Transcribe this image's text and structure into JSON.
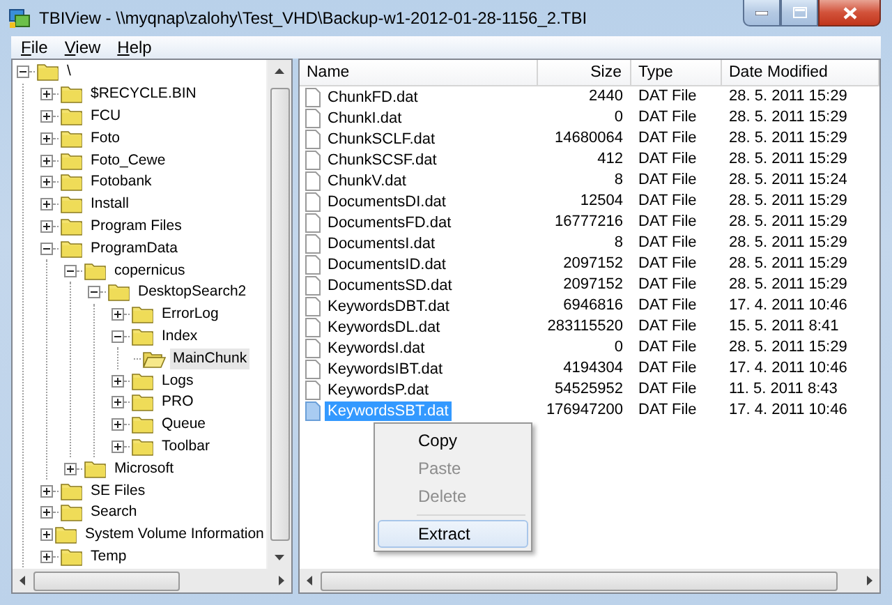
{
  "window": {
    "title": "TBIView - \\\\myqnap\\zalohy\\Test_VHD\\Backup-w1-2012-01-28-1156_2.TBI"
  },
  "menu": [
    {
      "label": "File"
    },
    {
      "label": "View"
    },
    {
      "label": "Help"
    }
  ],
  "tree": [
    {
      "label": "\\",
      "expanded": true,
      "selected": false,
      "children": [
        {
          "label": "$RECYCLE.BIN",
          "expanded": false,
          "selected": false
        },
        {
          "label": "FCU",
          "expanded": false,
          "selected": false
        },
        {
          "label": "Foto",
          "expanded": false,
          "selected": false
        },
        {
          "label": "Foto_Cewe",
          "expanded": false,
          "selected": false
        },
        {
          "label": "Fotobank",
          "expanded": false,
          "selected": false
        },
        {
          "label": "Install",
          "expanded": false,
          "selected": false
        },
        {
          "label": "Program Files",
          "expanded": false,
          "selected": false
        },
        {
          "label": "ProgramData",
          "expanded": true,
          "selected": false,
          "children": [
            {
              "label": "copernicus",
              "expanded": true,
              "selected": false,
              "children": [
                {
                  "label": "DesktopSearch2",
                  "expanded": true,
                  "selected": false,
                  "children": [
                    {
                      "label": "ErrorLog",
                      "expanded": false,
                      "selected": false
                    },
                    {
                      "label": "Index",
                      "expanded": true,
                      "selected": false,
                      "children": [
                        {
                          "label": "MainChunk",
                          "selected": true
                        }
                      ]
                    },
                    {
                      "label": "Logs",
                      "expanded": false,
                      "selected": false
                    },
                    {
                      "label": "PRO",
                      "expanded": false,
                      "selected": false
                    },
                    {
                      "label": "Queue",
                      "expanded": false,
                      "selected": false
                    },
                    {
                      "label": "Toolbar",
                      "expanded": false,
                      "selected": false
                    }
                  ]
                }
              ]
            },
            {
              "label": "Microsoft",
              "expanded": false,
              "selected": false
            }
          ]
        },
        {
          "label": "SE Files",
          "expanded": false,
          "selected": false
        },
        {
          "label": "Search",
          "expanded": false,
          "selected": false
        },
        {
          "label": "System Volume Information",
          "expanded": false,
          "selected": false
        },
        {
          "label": "Temp",
          "expanded": false,
          "selected": false
        }
      ]
    }
  ],
  "table": {
    "columns": [
      "Name",
      "Size",
      "Type",
      "Date Modified"
    ],
    "rows": [
      {
        "name": "ChunkFD.dat",
        "size": "2440",
        "type": "DAT File",
        "date": "28. 5. 2011 15:29",
        "selected": false
      },
      {
        "name": "ChunkI.dat",
        "size": "0",
        "type": "DAT File",
        "date": "28. 5. 2011 15:29",
        "selected": false
      },
      {
        "name": "ChunkSCLF.dat",
        "size": "14680064",
        "type": "DAT File",
        "date": "28. 5. 2011 15:29",
        "selected": false
      },
      {
        "name": "ChunkSCSF.dat",
        "size": "412",
        "type": "DAT File",
        "date": "28. 5. 2011 15:29",
        "selected": false
      },
      {
        "name": "ChunkV.dat",
        "size": "8",
        "type": "DAT File",
        "date": "28. 5. 2011 15:24",
        "selected": false
      },
      {
        "name": "DocumentsDI.dat",
        "size": "12504",
        "type": "DAT File",
        "date": "28. 5. 2011 15:29",
        "selected": false
      },
      {
        "name": "DocumentsFD.dat",
        "size": "16777216",
        "type": "DAT File",
        "date": "28. 5. 2011 15:29",
        "selected": false
      },
      {
        "name": "DocumentsI.dat",
        "size": "8",
        "type": "DAT File",
        "date": "28. 5. 2011 15:29",
        "selected": false
      },
      {
        "name": "DocumentsID.dat",
        "size": "2097152",
        "type": "DAT File",
        "date": "28. 5. 2011 15:29",
        "selected": false
      },
      {
        "name": "DocumentsSD.dat",
        "size": "2097152",
        "type": "DAT File",
        "date": "28. 5. 2011 15:29",
        "selected": false
      },
      {
        "name": "KeywordsDBT.dat",
        "size": "6946816",
        "type": "DAT File",
        "date": "17. 4. 2011 10:46",
        "selected": false
      },
      {
        "name": "KeywordsDL.dat",
        "size": "283115520",
        "type": "DAT File",
        "date": "15. 5. 2011 8:41",
        "selected": false
      },
      {
        "name": "KeywordsI.dat",
        "size": "0",
        "type": "DAT File",
        "date": "28. 5. 2011 15:29",
        "selected": false
      },
      {
        "name": "KeywordsIBT.dat",
        "size": "4194304",
        "type": "DAT File",
        "date": "17. 4. 2011 10:46",
        "selected": false
      },
      {
        "name": "KeywordsP.dat",
        "size": "54525952",
        "type": "DAT File",
        "date": "11. 5. 2011 8:43",
        "selected": false
      },
      {
        "name": "KeywordsSBT.dat",
        "size": "176947200",
        "type": "DAT File",
        "date": "17. 4. 2011 10:46",
        "selected": true
      }
    ]
  },
  "context_menu": [
    {
      "kind": "item",
      "label": "Copy",
      "disabled": false,
      "selected": false
    },
    {
      "kind": "item",
      "label": "Paste",
      "disabled": true,
      "selected": false
    },
    {
      "kind": "item",
      "label": "Delete",
      "disabled": true,
      "selected": false
    },
    {
      "kind": "separator"
    },
    {
      "kind": "item",
      "label": "Extract",
      "disabled": false,
      "selected": true
    }
  ]
}
